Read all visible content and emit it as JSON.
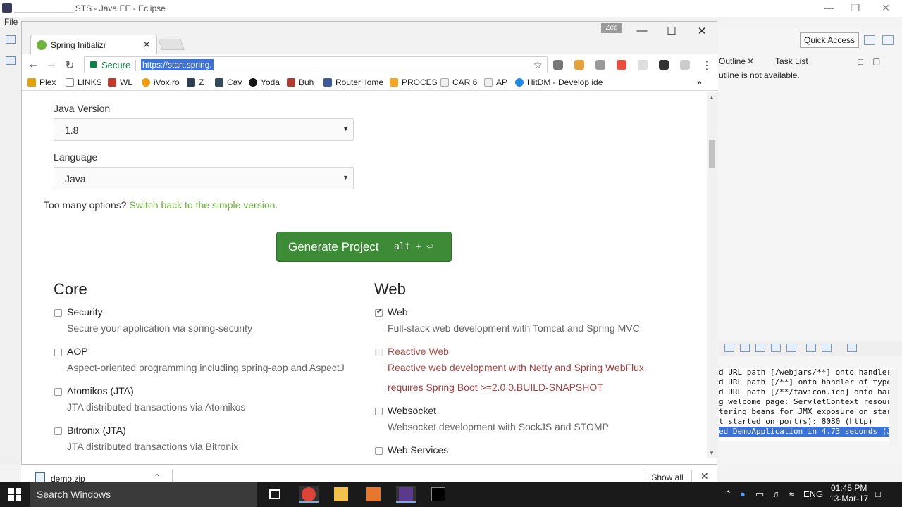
{
  "eclipse": {
    "title": "_____________STS - Java EE - Eclipse",
    "menu_file": "File",
    "quick_access": "Quick Access",
    "outline_tab": "Outline",
    "task_list_tab": "Task List",
    "outline_message": "utline is not available.",
    "console_lines": [
      "d URL path [/webjars/**] onto handler",
      "d URL path [/**] onto handler of type",
      "d URL path [/**/favicon.ico] onto har",
      "g welcome page: ServletContext resour",
      "tering beans for JMX exposure on star",
      "t started on port(s): 8080 (http)",
      "ed DemoApplication in 4.73 seconds (J"
    ]
  },
  "chrome": {
    "tab_title": "Spring Initializr",
    "profile_label": "Zee",
    "secure_label": "Secure",
    "url": "https://start.spring.",
    "bookmarks": [
      {
        "label": "Plex",
        "color": "#e5a00d"
      },
      {
        "label": "LINKS",
        "color": "#ffffff"
      },
      {
        "label": "WL",
        "color": "#c0392b"
      },
      {
        "label": "iVox.ro",
        "color": "#f39c12"
      },
      {
        "label": "Z",
        "color": "#2c3e50"
      },
      {
        "label": "Cav",
        "color": "#34495e"
      },
      {
        "label": "Yoda",
        "color": "#111111"
      },
      {
        "label": "Buh",
        "color": "#b03a2e"
      },
      {
        "label": "RouterHome",
        "color": "#3b5998"
      },
      {
        "label": "PROCES",
        "color": "#f5a623"
      },
      {
        "label": "CAR 6",
        "color": "#f0f0f0"
      },
      {
        "label": "AP",
        "color": "#f0f0f0"
      },
      {
        "label": "HitDM - Develop ide",
        "color": "#1e88e5"
      }
    ]
  },
  "form": {
    "java_version_label": "Java Version",
    "java_version_value": "1.8",
    "language_label": "Language",
    "language_value": "Java",
    "too_many": "Too many options?",
    "switch_back": "Switch back to the simple version.",
    "generate_label": "Generate Project",
    "generate_shortcut": "alt + ⏎"
  },
  "core": {
    "title": "Core",
    "deps": [
      {
        "name": "Security",
        "desc": "Secure your application via spring-security",
        "checked": false
      },
      {
        "name": "AOP",
        "desc": "Aspect-oriented programming including spring-aop and AspectJ",
        "checked": false
      },
      {
        "name": "Atomikos (JTA)",
        "desc": "JTA distributed transactions via Atomikos",
        "checked": false
      },
      {
        "name": "Bitronix (JTA)",
        "desc": "JTA distributed transactions via Bitronix",
        "checked": false
      }
    ]
  },
  "web": {
    "title": "Web",
    "deps": [
      {
        "name": "Web",
        "desc": "Full-stack web development with Tomcat and Spring MVC",
        "checked": true
      },
      {
        "name": "Reactive Web",
        "desc": "Reactive web development with Netty and Spring WebFlux",
        "requirement": "requires Spring Boot >=2.0.0.BUILD-SNAPSHOT",
        "checked": false,
        "disabled": true
      },
      {
        "name": "Websocket",
        "desc": "Websocket development with SockJS and STOMP",
        "checked": false
      },
      {
        "name": "Web Services",
        "desc": "",
        "checked": false
      }
    ]
  },
  "download": {
    "file": "demo.zip",
    "show_all": "Show all"
  },
  "taskbar": {
    "search_placeholder": "Search Windows",
    "language": "ENG",
    "time": "01:45 PM",
    "date": "13-Mar-17"
  }
}
